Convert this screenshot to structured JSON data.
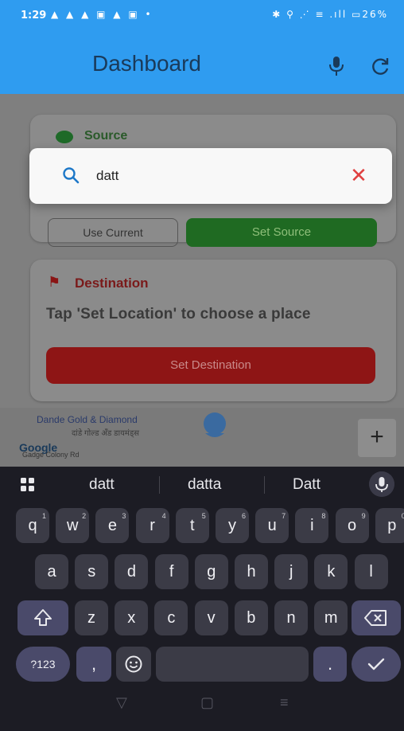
{
  "status_bar": {
    "time": "1:29",
    "left_icons": "▲ ▲ ▲ ▣ ▲ ▣ •",
    "right_icons": "✱ ⚲ ⋰ ≡ .ıll ▭26%"
  },
  "app_bar": {
    "title": "Dashboard"
  },
  "source_card": {
    "title": "Source",
    "use_current_label": "Use Current",
    "set_source_label": "Set Source"
  },
  "destination_card": {
    "title": "Destination",
    "hint": "Tap 'Set Location' to choose a place",
    "set_destination_label": "Set Destination"
  },
  "map": {
    "place_name": "Dande Gold & Diamond",
    "place_subtitle": "दांडे गोल्ड अँड डायमंड्स",
    "google_label": "Google",
    "area_label": "Gadge Colony Rd",
    "zoom_in_label": "+"
  },
  "search": {
    "value": "datt",
    "clear_label": "✕"
  },
  "keyboard": {
    "suggestions": [
      "datt",
      "datta",
      "Datt"
    ],
    "row1": [
      {
        "k": "q",
        "n": "1"
      },
      {
        "k": "w",
        "n": "2"
      },
      {
        "k": "e",
        "n": "3"
      },
      {
        "k": "r",
        "n": "4"
      },
      {
        "k": "t",
        "n": "5"
      },
      {
        "k": "y",
        "n": "6"
      },
      {
        "k": "u",
        "n": "7"
      },
      {
        "k": "i",
        "n": "8"
      },
      {
        "k": "o",
        "n": "9"
      },
      {
        "k": "p",
        "n": "0"
      }
    ],
    "row2": [
      "a",
      "s",
      "d",
      "f",
      "g",
      "h",
      "j",
      "k",
      "l"
    ],
    "row3": [
      "z",
      "x",
      "c",
      "v",
      "b",
      "n",
      "m"
    ],
    "symbols_label": "?123",
    "comma_label": ",",
    "period_label": "."
  },
  "colors": {
    "primary": "#2f9cf0",
    "source_green": "#1f6a22",
    "destination_red": "#8e1515",
    "clear_red": "#e04040",
    "keyboard_bg": "#1c1c24"
  }
}
